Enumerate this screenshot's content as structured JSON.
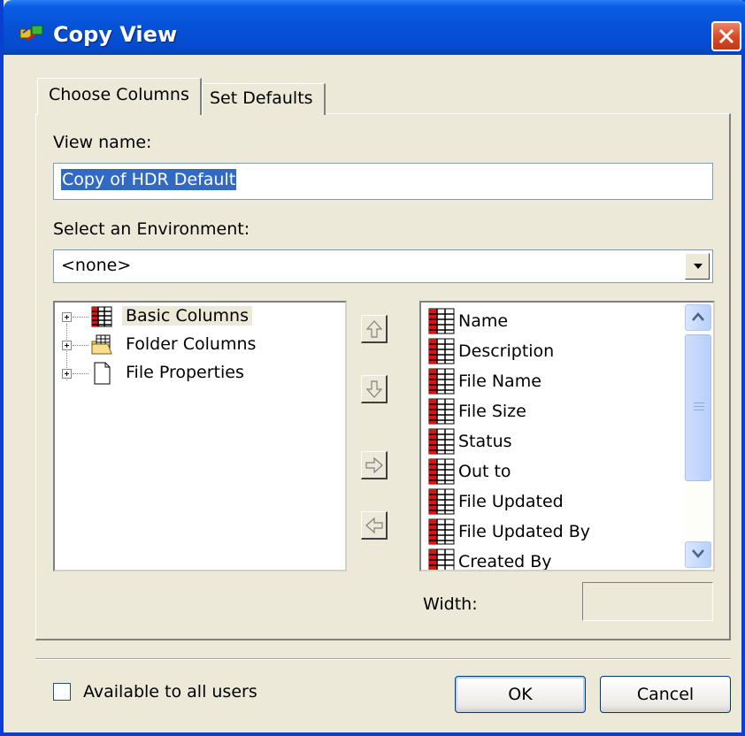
{
  "window": {
    "title": "Copy View"
  },
  "tabs": [
    {
      "label": "Choose Columns",
      "active": true
    },
    {
      "label": "Set Defaults",
      "active": false
    }
  ],
  "view_name": {
    "label": "View name:",
    "value": "Copy of HDR Default"
  },
  "environment": {
    "label": "Select an Environment:",
    "value": "<none>"
  },
  "tree": {
    "items": [
      {
        "label": "Basic Columns",
        "icon": "grid-icon",
        "highlighted": true
      },
      {
        "label": "Folder Columns",
        "icon": "folder-grid-icon",
        "highlighted": false
      },
      {
        "label": "File Properties",
        "icon": "page-icon",
        "highlighted": false
      }
    ]
  },
  "move_buttons": [
    {
      "name": "move-up-button",
      "icon": "arrow-up-icon"
    },
    {
      "name": "move-down-button",
      "icon": "arrow-down-icon"
    },
    {
      "name": "add-column-button",
      "icon": "arrow-right-icon"
    },
    {
      "name": "remove-column-button",
      "icon": "arrow-left-icon"
    }
  ],
  "selected_columns": [
    "Name",
    "Description",
    "File Name",
    "File Size",
    "Status",
    "Out to",
    "File Updated",
    "File Updated By",
    "Created By"
  ],
  "width": {
    "label": "Width:",
    "value": ""
  },
  "available_to_all": {
    "label": "Available to all users",
    "checked": false
  },
  "buttons": {
    "ok": "OK",
    "cancel": "Cancel"
  },
  "colors": {
    "title_blue": "#0651d6",
    "close_red": "#d44a25",
    "selection": "#316ac5",
    "face": "#ece9d8"
  }
}
